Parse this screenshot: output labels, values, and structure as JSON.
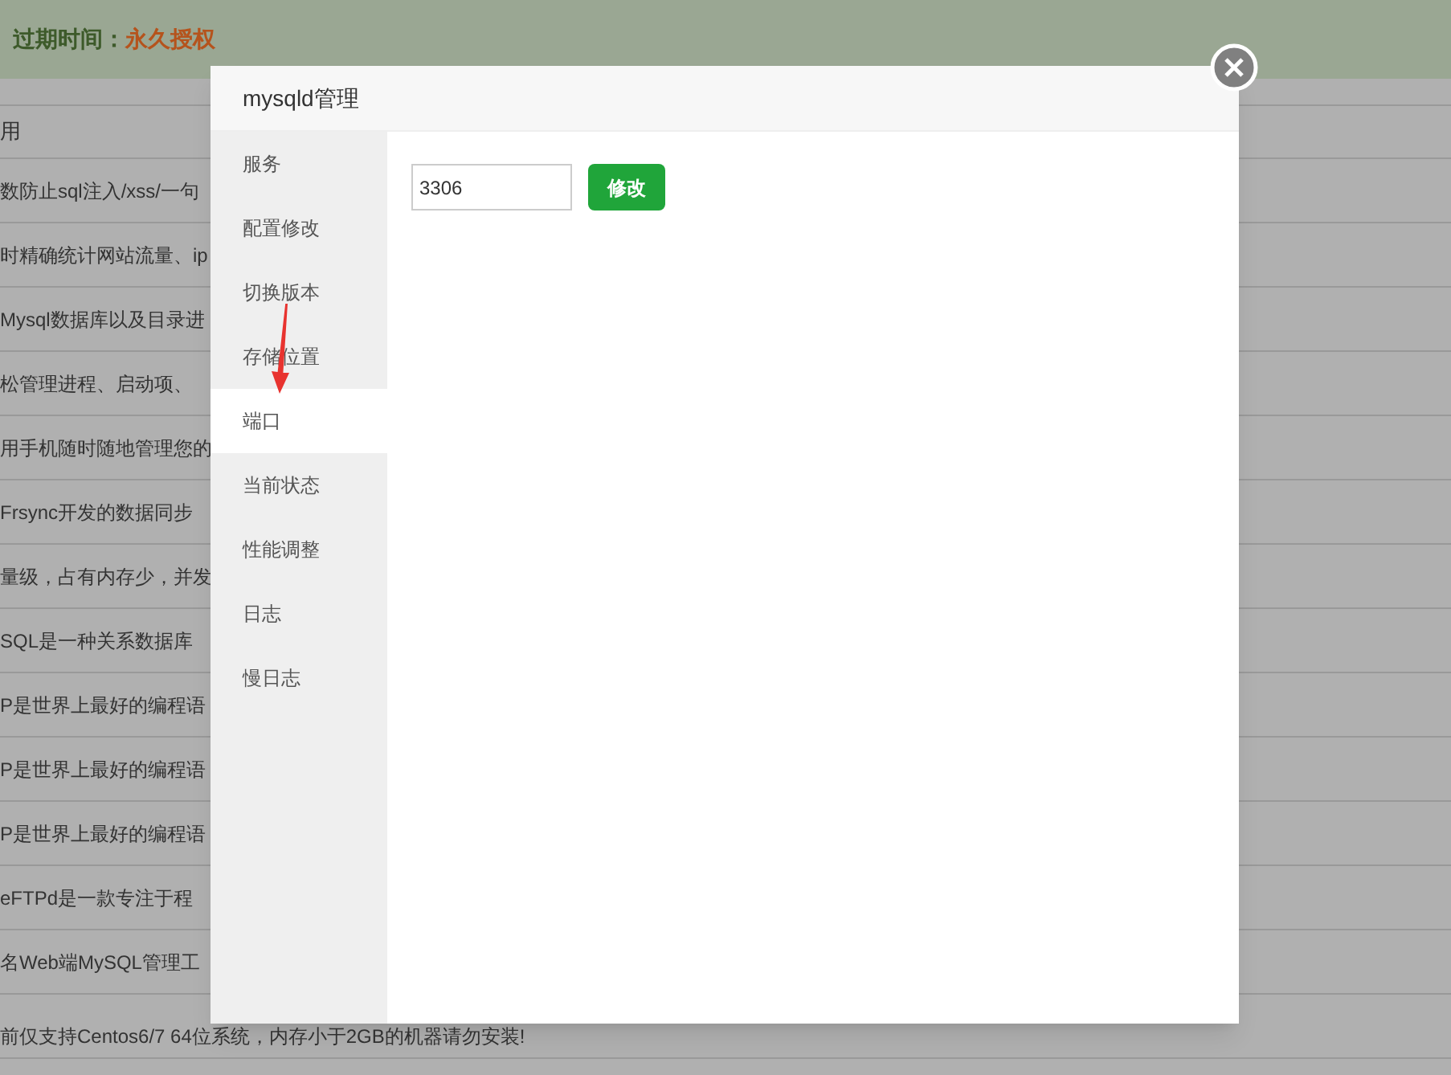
{
  "header": {
    "label": "过期时间：",
    "value": "永久授权"
  },
  "table": {
    "header": "用",
    "rows": [
      "数防止sql注入/xss/一句",
      "时精确统计网站流量、ip",
      "Mysql数据库以及目录进",
      "松管理进程、启动项、",
      "用手机随时随地管理您的",
      "Frsync开发的数据同步",
      "量级，占有内存少，并发",
      "SQL是一种关系数据库",
      "P是世界上最好的编程语",
      "P是世界上最好的编程语",
      "P是世界上最好的编程语",
      "eFTPd是一款专注于程",
      "名Web端MySQL管理工",
      "前仅支持Centos6/7 64位系统，内存小于2GB的机器请勿安装!"
    ]
  },
  "dialog": {
    "title": "mysqld管理",
    "menu": [
      {
        "label": "服务",
        "selected": false
      },
      {
        "label": "配置修改",
        "selected": false
      },
      {
        "label": "切换版本",
        "selected": false
      },
      {
        "label": "存储位置",
        "selected": false
      },
      {
        "label": "端口",
        "selected": true
      },
      {
        "label": "当前状态",
        "selected": false
      },
      {
        "label": "性能调整",
        "selected": false
      },
      {
        "label": "日志",
        "selected": false
      },
      {
        "label": "慢日志",
        "selected": false
      }
    ],
    "port": {
      "value": "3306"
    },
    "button": "修改"
  }
}
